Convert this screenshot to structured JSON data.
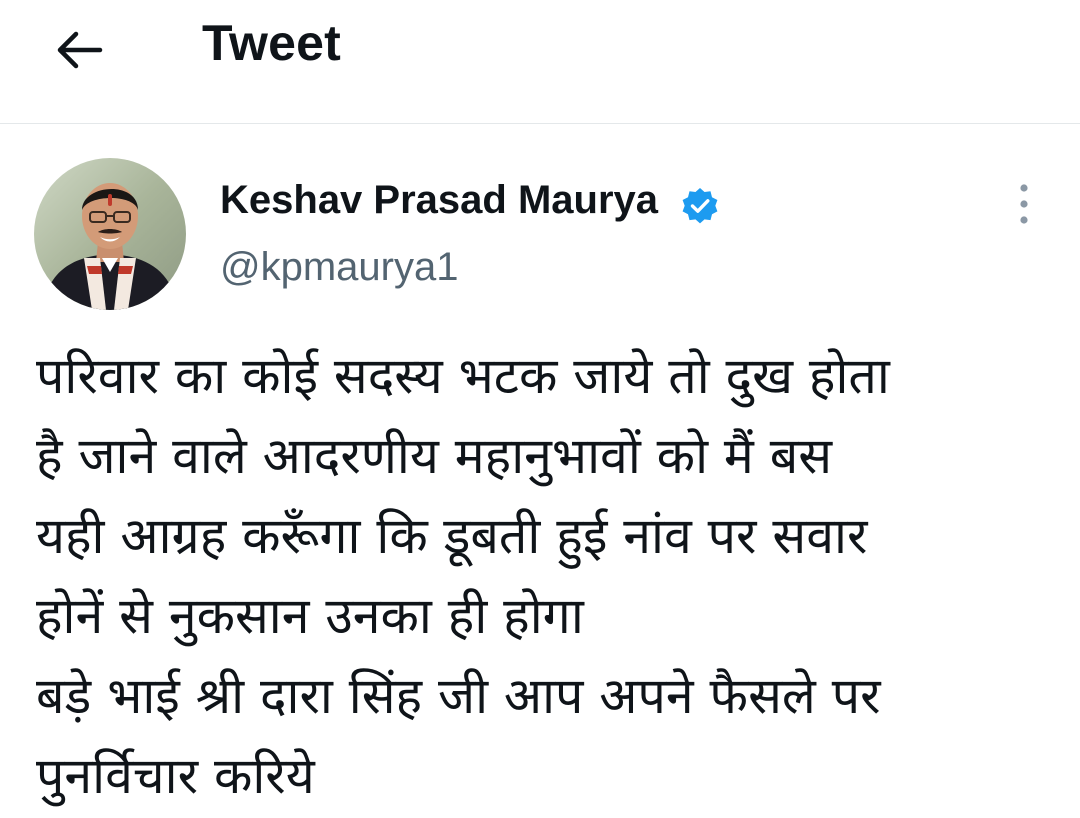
{
  "header": {
    "back_icon": "arrow-left-icon",
    "title": "Tweet"
  },
  "tweet": {
    "author": {
      "name": "Keshav Prasad Maurya",
      "handle": "@kpmaurya1",
      "verified": true,
      "verified_icon": "verified-badge-icon",
      "verified_color": "#1d9bf0"
    },
    "more_icon": "more-vertical-icon",
    "text": "परिवार का कोई सदस्य भटक जाये तो दुख होता\nहै जाने वाले आदरणीय महानुभावों को मैं बस\nयही आग्रह करूँगा कि डूबती हुई नांव पर सवार\nहोनें से नुकसान उनका ही होगा\nबड़े भाई श्री दारा सिंह जी आप अपने फैसले पर\nपुनर्विचार करिये"
  },
  "colors": {
    "text_primary": "#0f1419",
    "text_secondary": "#536471",
    "divider": "#e4e8ea",
    "accent": "#1d9bf0"
  }
}
